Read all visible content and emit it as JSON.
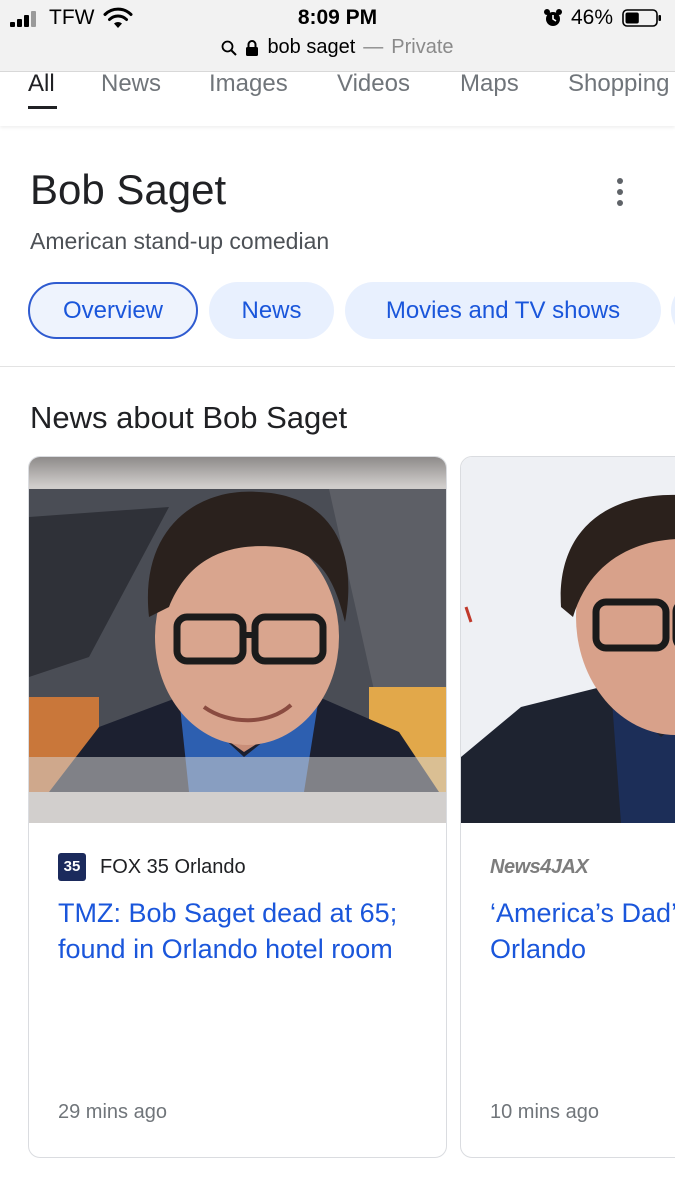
{
  "status_bar": {
    "carrier": "TFW",
    "time": "8:09 PM",
    "battery": "46%",
    "battery_level": 0.46
  },
  "url_bar": {
    "query": "bob saget",
    "separator": "—",
    "mode": "Private"
  },
  "tabs": [
    {
      "label": "All",
      "active": true
    },
    {
      "label": "News",
      "active": false
    },
    {
      "label": "Images",
      "active": false
    },
    {
      "label": "Videos",
      "active": false
    },
    {
      "label": "Maps",
      "active": false
    },
    {
      "label": "Shopping",
      "active": false
    }
  ],
  "entity": {
    "title": "Bob Saget",
    "subtitle": "American stand-up comedian",
    "chips": [
      {
        "label": "Overview",
        "selected": true
      },
      {
        "label": "News",
        "selected": false
      },
      {
        "label": "Movies and TV shows",
        "selected": false
      }
    ]
  },
  "news": {
    "section_title": "News about Bob Saget",
    "cards": [
      {
        "source": "FOX 35 Orlando",
        "source_logo": "35",
        "headline": "TMZ: Bob Saget dead at 65; found in Orlando hotel room",
        "time": "29 mins ago"
      },
      {
        "source_logo": "News4JAX",
        "headline": "‘America’s Dad’ dies at Orlando",
        "time": "10 mins ago"
      }
    ]
  },
  "colors": {
    "link_blue": "#1a56db",
    "chip_bg": "#e8f0fe",
    "muted_text": "#70757a"
  }
}
